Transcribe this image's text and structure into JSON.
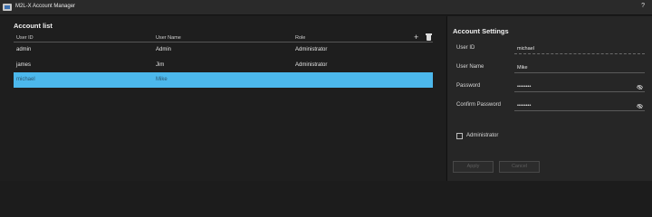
{
  "app": {
    "title": "M2L-X Account Manager",
    "help": "?"
  },
  "account_list": {
    "title": "Account list",
    "columns": [
      "User ID",
      "User Name",
      "Role"
    ],
    "rows": [
      {
        "user_id": "admin",
        "user_name": "Admin",
        "role": "Administrator",
        "selected": false
      },
      {
        "user_id": "james",
        "user_name": "Jim",
        "role": "Administrator",
        "selected": false
      },
      {
        "user_id": "michael",
        "user_name": "Mike",
        "role": "",
        "selected": true
      }
    ],
    "add_icon": "plus-icon",
    "delete_icon": "trash-icon"
  },
  "settings": {
    "title": "Account Settings",
    "user_id_label": "User ID",
    "user_id_value": "michael",
    "user_name_label": "User Name",
    "user_name_value": "Mike",
    "password_label": "Password",
    "password_value": "••••••••",
    "confirm_label": "Confirm Password",
    "confirm_value": "••••••••",
    "visibility_icon": "eye-off-icon",
    "administrator_label": "Administrator",
    "administrator_checked": false,
    "apply_label": "Apply",
    "cancel_label": "Cancel"
  },
  "colors": {
    "selected_row": "#4cb8ec",
    "background": "#1c1c1c",
    "panel": "#262626"
  }
}
